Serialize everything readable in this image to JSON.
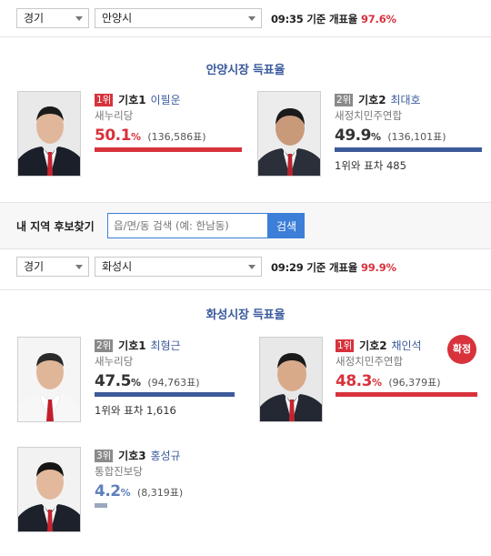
{
  "anyang": {
    "province": "경기",
    "city": "안양시",
    "time": "09:35",
    "status_label": "기준 개표율",
    "count_rate": "97.6%",
    "section_title": "안양시장 득표율",
    "candidates": [
      {
        "rank": "1위",
        "ballot": "기호1",
        "name": "이필운",
        "party": "새누리당",
        "percent": "50.1",
        "percent_unit": "%",
        "votes": "(136,586표)",
        "share": 50.1,
        "color": "#d8323c"
      },
      {
        "rank": "2위",
        "ballot": "기호2",
        "name": "최대호",
        "party": "새정치민주연합",
        "percent": "49.9",
        "percent_unit": "%",
        "votes": "(136,101표)",
        "share": 49.9,
        "gap": "1위와 표차 485",
        "color": "#3d5a9a"
      }
    ]
  },
  "search": {
    "label": "내 지역 후보찾기",
    "placeholder": "읍/면/동 검색 (예: 한남동)",
    "button": "검색"
  },
  "hwaseong": {
    "province": "경기",
    "city": "화성시",
    "time": "09:29",
    "status_label": "기준 개표율",
    "count_rate": "99.9%",
    "section_title": "화성시장 득표율",
    "confirmed_badge": "확정",
    "candidates": [
      {
        "rank": "2위",
        "ballot": "기호1",
        "name": "최형근",
        "party": "새누리당",
        "percent": "47.5",
        "percent_unit": "%",
        "votes": "(94,763표)",
        "share": 47.5,
        "gap": "1위와 표차 1,616",
        "color": "#3d5a9a"
      },
      {
        "rank": "1위",
        "ballot": "기호2",
        "name": "채인석",
        "party": "새정치민주연합",
        "percent": "48.3",
        "percent_unit": "%",
        "votes": "(96,379표)",
        "share": 48.3,
        "color": "#d8323c"
      },
      {
        "rank": "3위",
        "ballot": "기호3",
        "name": "홍성규",
        "party": "통합진보당",
        "percent": "4.2",
        "percent_unit": "%",
        "votes": "(8,319표)",
        "share": 4.2,
        "color": "#9aa7bf"
      }
    ]
  }
}
